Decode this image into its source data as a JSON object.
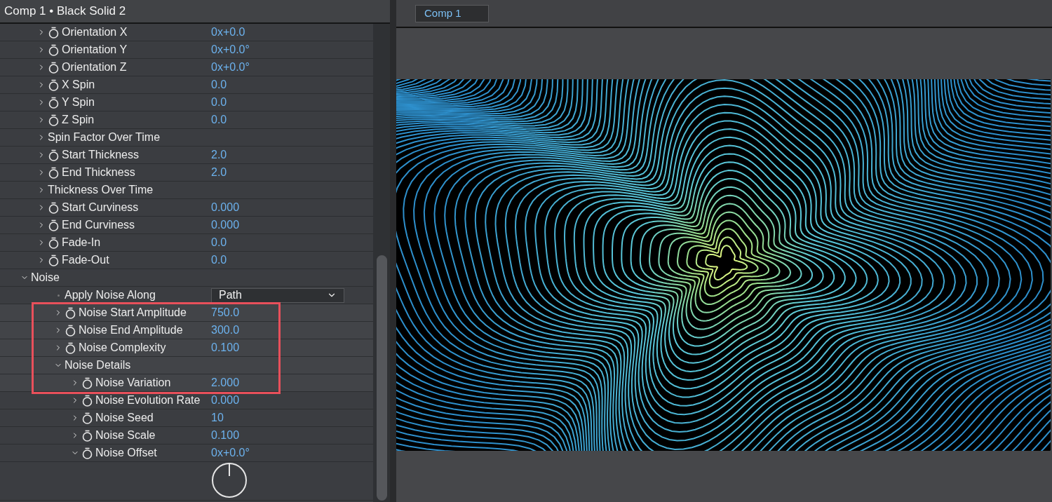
{
  "effect_panel": {
    "title": "Comp 1 • Black Solid 2",
    "tree": [
      {
        "kind": "continued",
        "children": [
          {
            "kind": "property",
            "label": "Orientation X",
            "value": "0x+0.0",
            "expanded": false,
            "highlighted": false
          },
          {
            "kind": "property",
            "label": "Orientation Y",
            "value": "0x+0.0°",
            "expanded": false,
            "highlighted": false
          },
          {
            "kind": "property",
            "label": "Orientation Z",
            "value": "0x+0.0°",
            "expanded": false,
            "highlighted": false
          },
          {
            "kind": "property",
            "label": "X Spin",
            "value": "0.0",
            "expanded": false,
            "highlighted": false
          },
          {
            "kind": "property",
            "label": "Y Spin",
            "value": "0.0",
            "expanded": false,
            "highlighted": false
          },
          {
            "kind": "property",
            "label": "Z Spin",
            "value": "0.0",
            "expanded": false,
            "highlighted": false
          },
          {
            "kind": "group",
            "label": "Spin Factor Over Time",
            "expanded": false,
            "highlighted": false
          },
          {
            "kind": "property",
            "label": "Start Thickness",
            "value": "2.0",
            "expanded": false,
            "highlighted": false
          },
          {
            "kind": "property",
            "label": "End Thickness",
            "value": "2.0",
            "expanded": false,
            "highlighted": false
          },
          {
            "kind": "group",
            "label": "Thickness Over Time",
            "expanded": false,
            "highlighted": false
          },
          {
            "kind": "property",
            "label": "Start Curviness",
            "value": "0.000",
            "expanded": false,
            "highlighted": false
          },
          {
            "kind": "property",
            "label": "End Curviness",
            "value": "0.000",
            "expanded": false,
            "highlighted": false
          },
          {
            "kind": "property",
            "label": "Fade-In",
            "value": "0.0",
            "expanded": false,
            "highlighted": false
          },
          {
            "kind": "property",
            "label": "Fade-Out",
            "value": "0.0",
            "expanded": false,
            "highlighted": false
          }
        ]
      },
      {
        "kind": "group",
        "label": "Noise",
        "expanded": true,
        "highlighted": false,
        "children": [
          {
            "kind": "dropdown",
            "label": "Apply Noise Along",
            "value": "Path",
            "highlighted": false
          },
          {
            "kind": "property",
            "label": "Noise Start Amplitude",
            "value": "750.0",
            "expanded": false,
            "highlighted": true
          },
          {
            "kind": "property",
            "label": "Noise End Amplitude",
            "value": "300.0",
            "expanded": false,
            "highlighted": true
          },
          {
            "kind": "property",
            "label": "Noise Complexity",
            "value": "0.100",
            "expanded": false,
            "highlighted": true
          },
          {
            "kind": "group",
            "label": "Noise Details",
            "expanded": true,
            "highlighted": true,
            "children": [
              {
                "kind": "property",
                "label": "Noise Variation",
                "value": "2.000",
                "expanded": false,
                "highlighted": true
              },
              {
                "kind": "property",
                "label": "Noise Evolution Rate",
                "value": "0.000",
                "expanded": false,
                "highlighted": false
              },
              {
                "kind": "property",
                "label": "Noise Seed",
                "value": "10",
                "expanded": false,
                "highlighted": false
              },
              {
                "kind": "property",
                "label": "Noise Scale",
                "value": "0.100",
                "expanded": false,
                "highlighted": false
              },
              {
                "kind": "angle",
                "label": "Noise Offset",
                "value": "0x+0.0°",
                "expanded": true,
                "highlighted": false
              }
            ]
          }
        ]
      }
    ]
  },
  "viewer": {
    "tabs": [
      {
        "label": "Comp 1",
        "selected": true
      }
    ]
  }
}
